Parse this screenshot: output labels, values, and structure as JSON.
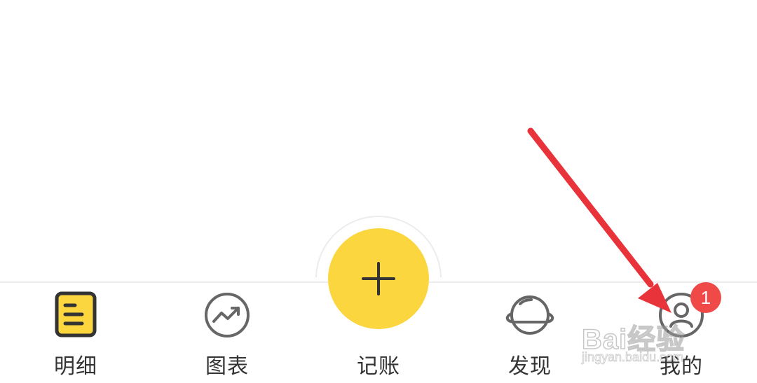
{
  "tabbar": {
    "tabs": [
      {
        "label": "明细",
        "icon": "detail-note-icon",
        "active": true
      },
      {
        "label": "图表",
        "icon": "chart-trend-icon",
        "active": false
      },
      {
        "label": "发现",
        "icon": "planet-icon",
        "active": false
      },
      {
        "label": "我的",
        "icon": "user-icon",
        "active": false
      }
    ],
    "center": {
      "label": "记账",
      "icon": "plus-icon"
    },
    "profile_badge": "1"
  },
  "watermark": {
    "brand": "Bai经验",
    "url": "jingyan.baidu.com"
  },
  "colors": {
    "accent_yellow": "#fcd63e",
    "badge_red": "#f04a48",
    "annotation_arrow": "#e8333a",
    "icon_gray": "#666666",
    "text": "#333333"
  }
}
